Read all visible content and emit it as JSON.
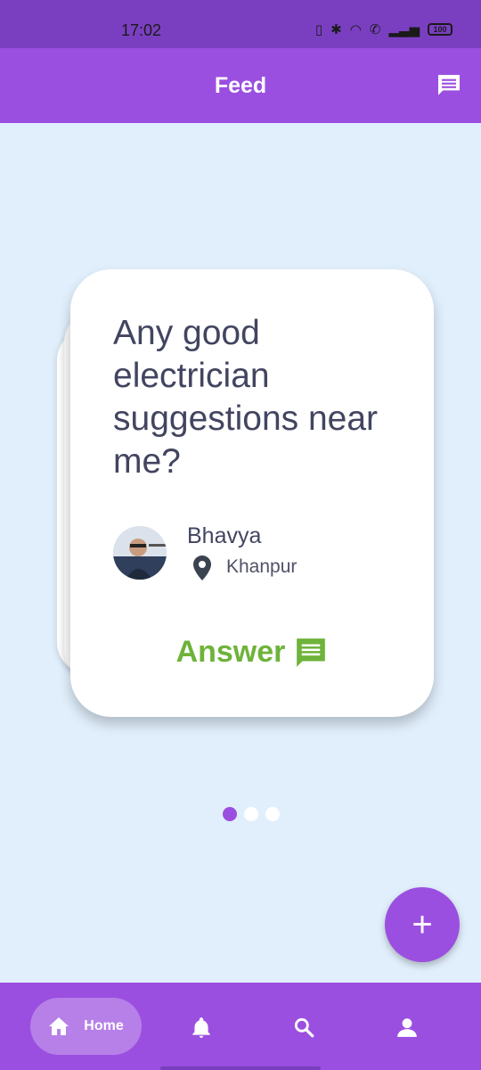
{
  "status_bar": {
    "time": "17:02",
    "battery": "100"
  },
  "app_bar": {
    "title": "Feed"
  },
  "card": {
    "question": "Any good electrician suggestions near me?",
    "author": "Bhavya",
    "location": "Khanpur",
    "answer_label": "Answer"
  },
  "pager": {
    "pages": 3,
    "active": 0
  },
  "fab": {
    "label": "+"
  },
  "bottom_nav": {
    "items": [
      {
        "label": "Home",
        "icon": "home-icon",
        "active": true
      },
      {
        "icon": "bell-icon"
      },
      {
        "icon": "search-icon"
      },
      {
        "icon": "person-icon"
      }
    ]
  },
  "colors": {
    "primary": "#9b4fe0",
    "status_bar": "#7a3fc0",
    "background": "#e1effc",
    "answer": "#6eb33b",
    "text": "#424560"
  }
}
